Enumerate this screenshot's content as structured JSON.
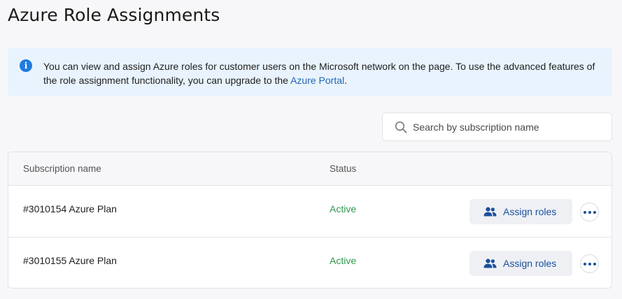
{
  "page": {
    "title": "Azure Role Assignments"
  },
  "info_banner": {
    "text_before": "You can view and assign Azure roles for customer users on the Microsoft network on the page. To use the advanced features of the role assignment functionality, you can upgrade to the ",
    "link_text": "Azure Portal",
    "text_after": ".",
    "icon": "info-icon"
  },
  "search": {
    "placeholder": "Search by subscription name",
    "value": ""
  },
  "table": {
    "columns": [
      "Subscription name",
      "Status"
    ],
    "rows": [
      {
        "name": "#3010154 Azure Plan",
        "status": "Active",
        "action_label": "Assign roles"
      },
      {
        "name": "#3010155 Azure Plan",
        "status": "Active",
        "action_label": "Assign roles"
      }
    ]
  },
  "colors": {
    "accent": "#1a4f9c",
    "info_icon": "#1f7be0",
    "status_active": "#2f9a4f",
    "banner_bg": "#e8f3fd"
  }
}
